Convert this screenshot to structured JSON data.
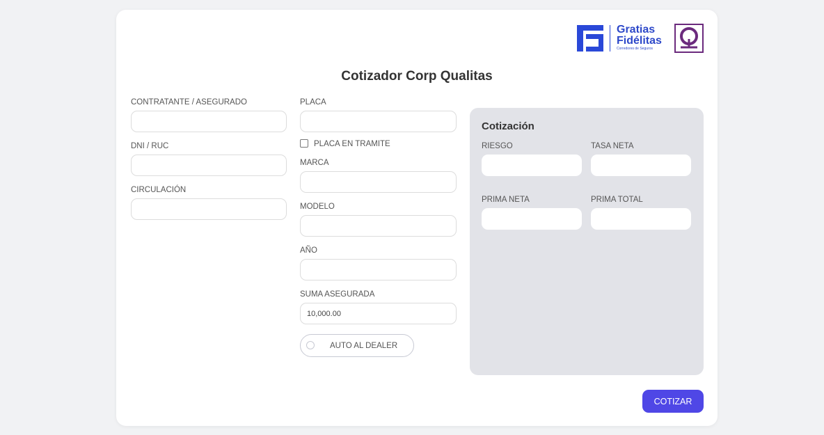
{
  "brand": {
    "line1": "Gratias",
    "line2": "Fidélitas",
    "tagline": "Corredores de Seguros",
    "primary_color": "#2d48c9",
    "secondary_logo_color": "#6b2a7d"
  },
  "page": {
    "title": "Cotizador Corp Qualitas"
  },
  "form": {
    "contratante_label": "CONTRATANTE / ASEGURADO",
    "contratante_value": "",
    "dni_label": "DNI / RUC",
    "dni_value": "",
    "circulacion_label": "CIRCULACIÓN",
    "circulacion_value": "",
    "placa_label": "PLACA",
    "placa_value": "",
    "placa_tramite_label": "PLACA EN TRAMITE",
    "placa_tramite_checked": false,
    "marca_label": "MARCA",
    "marca_value": "",
    "modelo_label": "MODELO",
    "modelo_value": "",
    "anio_label": "AÑO",
    "anio_value": "",
    "suma_label": "SUMA ASEGURADA",
    "suma_value": "10,000.00",
    "dealer_label": "AUTO AL DEALER",
    "dealer_on": false
  },
  "quote": {
    "title": "Cotización",
    "riesgo_label": "RIESGO",
    "tasa_label": "TASA NETA",
    "prima_neta_label": "PRIMA NETA",
    "prima_total_label": "PRIMA TOTAL"
  },
  "actions": {
    "cotizar_label": "COTIZAR",
    "cotizar_color": "#4f47e6"
  }
}
